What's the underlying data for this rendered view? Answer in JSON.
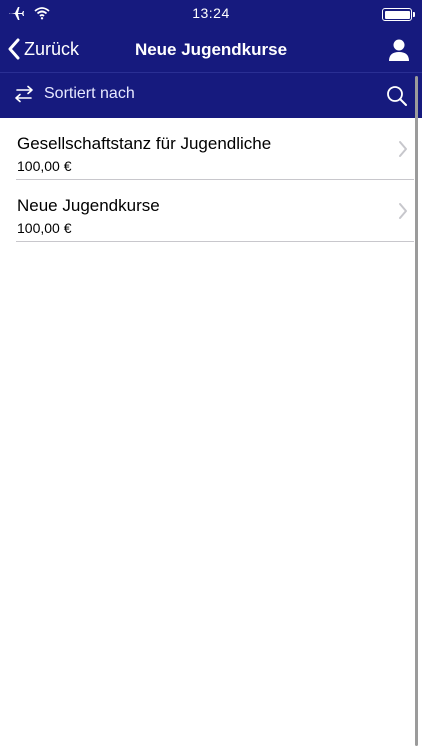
{
  "status_bar": {
    "time": "13:24",
    "icons": [
      "airplane-icon",
      "wifi-icon",
      "battery-icon"
    ]
  },
  "nav": {
    "back_label": "Zurück",
    "title": "Neue Jugendkurse",
    "profile_icon": "person-icon"
  },
  "sort_bar": {
    "label": "Sortiert nach",
    "sort_icon": "swap-arrows-icon",
    "search_icon": "search-icon"
  },
  "items": [
    {
      "name": "Gesellschaftstanz für Jugendliche",
      "price": "100,00 €"
    },
    {
      "name": "Neue Jugendkurse",
      "price": "100,00 €"
    }
  ],
  "colors": {
    "header_bg": "#161a7e",
    "header_text": "#ffffff",
    "separator": "#c8c7cc",
    "chevron": "#c7c7cc"
  }
}
